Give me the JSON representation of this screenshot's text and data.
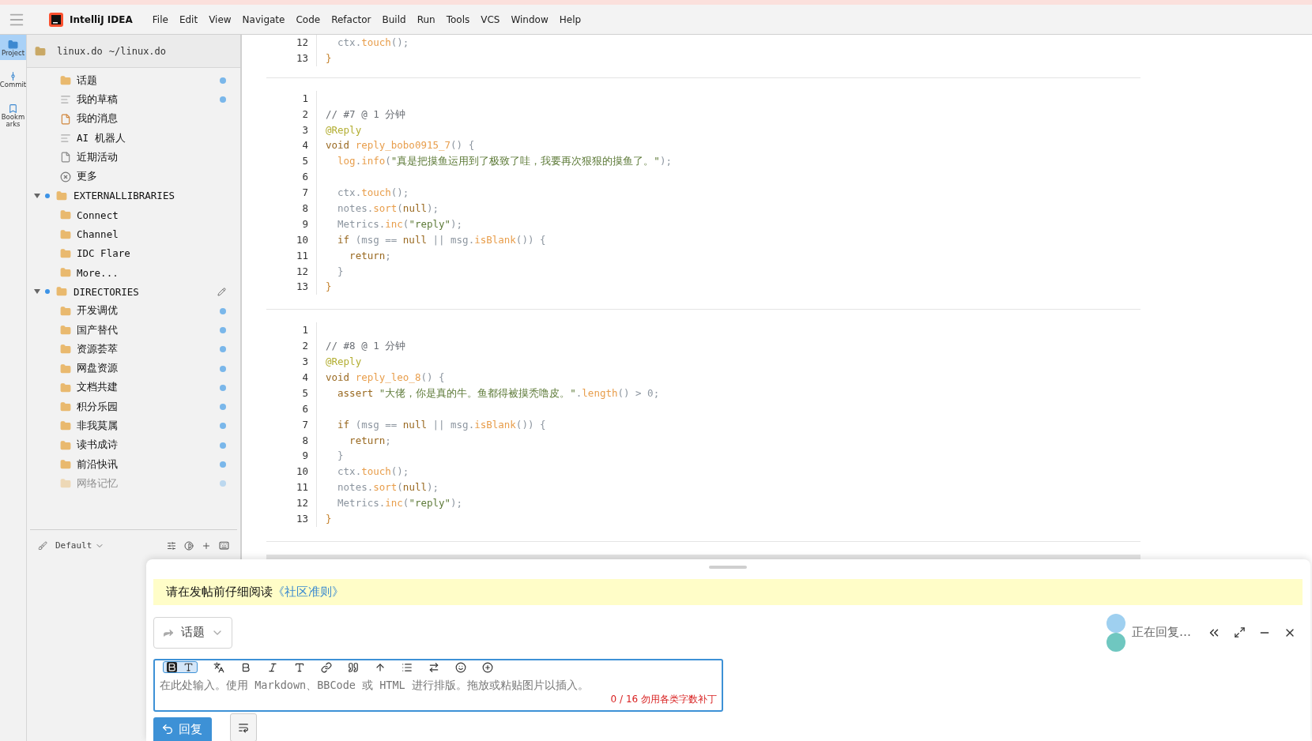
{
  "menubar": {
    "app": "IntelliJ IDEA",
    "menus": [
      "File",
      "Edit",
      "View",
      "Navigate",
      "Code",
      "Refactor",
      "Build",
      "Run",
      "Tools",
      "VCS",
      "Window",
      "Help"
    ]
  },
  "rail": [
    {
      "label": "Project",
      "kind": "folder",
      "selected": true
    },
    {
      "label": "Commit",
      "kind": "commit",
      "selected": false
    },
    {
      "label": "Bookmarks",
      "kind": "bookmark",
      "selected": false
    }
  ],
  "sidebar": {
    "header": {
      "name": "linux.do",
      "path": "~/linux.do"
    },
    "tree": [
      {
        "label": "话题",
        "kind": "folder",
        "unread": true
      },
      {
        "label": "我的草稿",
        "kind": "lines",
        "unread": true
      },
      {
        "label": "我的消息",
        "kind": "note",
        "unread": false
      },
      {
        "label": "AI 机器人",
        "kind": "lines",
        "unread": false
      },
      {
        "label": "近期活动",
        "kind": "page",
        "unread": false
      },
      {
        "label": "更多",
        "kind": "more",
        "unread": false
      },
      {
        "label": "EXTERNALLIBRARIES",
        "expanded": true,
        "marked": true,
        "editable": false,
        "children": [
          {
            "label": "Connect",
            "kind": "folder",
            "unread": false
          },
          {
            "label": "Channel",
            "kind": "folder",
            "unread": false
          },
          {
            "label": "IDC Flare",
            "kind": "folder",
            "unread": false
          },
          {
            "label": "More...",
            "kind": "folder",
            "unread": false
          }
        ]
      },
      {
        "label": "DIRECTORIES",
        "expanded": true,
        "marked": true,
        "editable": true,
        "children": [
          {
            "label": "开发调优",
            "kind": "folder",
            "unread": true
          },
          {
            "label": "国产替代",
            "kind": "folder",
            "unread": true
          },
          {
            "label": "资源荟萃",
            "kind": "folder",
            "unread": true
          },
          {
            "label": "网盘资源",
            "kind": "folder",
            "unread": true
          },
          {
            "label": "文档共建",
            "kind": "folder",
            "unread": true
          },
          {
            "label": "积分乐园",
            "kind": "folder",
            "unread": true
          },
          {
            "label": "非我莫属",
            "kind": "folder",
            "unread": true
          },
          {
            "label": "读书成诗",
            "kind": "folder",
            "unread": true
          },
          {
            "label": "前沿快讯",
            "kind": "folder",
            "unread": true
          },
          {
            "label": "网络记忆",
            "kind": "folder",
            "unread": true,
            "faded": true
          }
        ]
      }
    ],
    "footer": {
      "theme": "Default"
    }
  },
  "editor": {
    "blocks": [
      {
        "lines": [
          {
            "number": "12",
            "tokens": [
              {
                "kind": "plain",
                "t": "  ctx."
              },
              {
                "kind": "fn",
                "t": "touch"
              },
              {
                "kind": "plain",
                "t": "();"
              }
            ]
          },
          {
            "number": "13",
            "tokens": [
              {
                "kind": "brace",
                "t": "}"
              }
            ]
          }
        ]
      },
      {
        "lines": [
          {
            "number": "1"
          },
          {
            "number": "2",
            "tokens": [
              {
                "kind": "comment",
                "t": "// #7 @ 1 分钟"
              }
            ]
          },
          {
            "number": "3",
            "tokens": [
              {
                "kind": "annotation",
                "t": "@Reply"
              }
            ]
          },
          {
            "number": "4",
            "tokens": [
              {
                "kind": "kw",
                "t": "void "
              },
              {
                "kind": "fn",
                "t": "reply_bobo0915_7"
              },
              {
                "kind": "plain",
                "t": "() {"
              }
            ]
          },
          {
            "number": "5",
            "tokens": [
              {
                "kind": "fn",
                "t": "  log"
              },
              {
                "kind": "plain",
                "t": "."
              },
              {
                "kind": "fn",
                "t": "info"
              },
              {
                "kind": "plain",
                "t": "("
              },
              {
                "kind": "str",
                "t": "\"真是把摸鱼运用到了极致了哇，我要再次狠狠的摸鱼了。\""
              },
              {
                "kind": "plain",
                "t": ");"
              }
            ]
          },
          {
            "number": "6"
          },
          {
            "number": "7",
            "tokens": [
              {
                "kind": "plain",
                "t": "  ctx."
              },
              {
                "kind": "fn",
                "t": "touch"
              },
              {
                "kind": "plain",
                "t": "();"
              }
            ]
          },
          {
            "number": "8",
            "tokens": [
              {
                "kind": "plain",
                "t": "  notes."
              },
              {
                "kind": "fn",
                "t": "sort"
              },
              {
                "kind": "plain",
                "t": "("
              },
              {
                "kind": "kw",
                "t": "null"
              },
              {
                "kind": "plain",
                "t": ");"
              }
            ]
          },
          {
            "number": "9",
            "tokens": [
              {
                "kind": "plain",
                "t": "  Metrics."
              },
              {
                "kind": "fn",
                "t": "inc"
              },
              {
                "kind": "plain",
                "t": "("
              },
              {
                "kind": "str",
                "t": "\"reply\""
              },
              {
                "kind": "plain",
                "t": ");"
              }
            ]
          },
          {
            "number": "10",
            "tokens": [
              {
                "kind": "kw",
                "t": "  if"
              },
              {
                "kind": "plain",
                "t": " (msg == "
              },
              {
                "kind": "kw",
                "t": "null"
              },
              {
                "kind": "plain",
                "t": " || msg."
              },
              {
                "kind": "fn",
                "t": "isBlank"
              },
              {
                "kind": "plain",
                "t": "()) {"
              }
            ]
          },
          {
            "number": "11",
            "tokens": [
              {
                "kind": "kw",
                "t": "    return"
              },
              {
                "kind": "plain",
                "t": ";"
              }
            ]
          },
          {
            "number": "12",
            "tokens": [
              {
                "kind": "plain",
                "t": "  }"
              }
            ]
          },
          {
            "number": "13",
            "tokens": [
              {
                "kind": "brace",
                "t": "}"
              }
            ]
          }
        ]
      },
      {
        "lines": [
          {
            "number": "1"
          },
          {
            "number": "2",
            "tokens": [
              {
                "kind": "comment",
                "t": "// #8 @ 1 分钟"
              }
            ]
          },
          {
            "number": "3",
            "tokens": [
              {
                "kind": "annotation",
                "t": "@Reply"
              }
            ]
          },
          {
            "number": "4",
            "tokens": [
              {
                "kind": "kw",
                "t": "void "
              },
              {
                "kind": "fn",
                "t": "reply_leo_8"
              },
              {
                "kind": "plain",
                "t": "() {"
              }
            ]
          },
          {
            "number": "5",
            "tokens": [
              {
                "kind": "kw",
                "t": "  assert"
              },
              {
                "kind": "str",
                "t": " \"大佬，你是真的牛。鱼都得被摸秃噜皮。\""
              },
              {
                "kind": "plain",
                "t": "."
              },
              {
                "kind": "fn",
                "t": "length"
              },
              {
                "kind": "plain",
                "t": "() > 0;"
              }
            ]
          },
          {
            "number": "6"
          },
          {
            "number": "7",
            "tokens": [
              {
                "kind": "kw",
                "t": "  if"
              },
              {
                "kind": "plain",
                "t": " (msg == "
              },
              {
                "kind": "kw",
                "t": "null"
              },
              {
                "kind": "plain",
                "t": " || msg."
              },
              {
                "kind": "fn",
                "t": "isBlank"
              },
              {
                "kind": "plain",
                "t": "()) {"
              }
            ]
          },
          {
            "number": "8",
            "tokens": [
              {
                "kind": "kw",
                "t": "    return"
              },
              {
                "kind": "plain",
                "t": ";"
              }
            ]
          },
          {
            "number": "9",
            "tokens": [
              {
                "kind": "plain",
                "t": "  }"
              }
            ]
          },
          {
            "number": "10",
            "tokens": [
              {
                "kind": "plain",
                "t": "  ctx."
              },
              {
                "kind": "fn",
                "t": "touch"
              },
              {
                "kind": "plain",
                "t": "();"
              }
            ]
          },
          {
            "number": "11",
            "tokens": [
              {
                "kind": "plain",
                "t": "  notes."
              },
              {
                "kind": "fn",
                "t": "sort"
              },
              {
                "kind": "plain",
                "t": "("
              },
              {
                "kind": "kw",
                "t": "null"
              },
              {
                "kind": "plain",
                "t": ");"
              }
            ]
          },
          {
            "number": "12",
            "tokens": [
              {
                "kind": "plain",
                "t": "  Metrics."
              },
              {
                "kind": "fn",
                "t": "inc"
              },
              {
                "kind": "plain",
                "t": "("
              },
              {
                "kind": "str",
                "t": "\"reply\""
              },
              {
                "kind": "plain",
                "t": ");"
              }
            ]
          },
          {
            "number": "13",
            "tokens": [
              {
                "kind": "brace",
                "t": "}"
              }
            ]
          }
        ]
      }
    ]
  },
  "composer": {
    "notice": {
      "text": "请在发帖前仔细阅读",
      "link": "《社区准则》"
    },
    "reply_type": "话题",
    "status": "正在回复…",
    "editor": {
      "markdown": true,
      "placeholder": "在此处输入。使用 Markdown、BBCode 或 HTML 进行排版。拖放或粘贴图片以插入。",
      "counter": "0 / 16 勿用各类字数补丁"
    },
    "submit": "回复"
  }
}
